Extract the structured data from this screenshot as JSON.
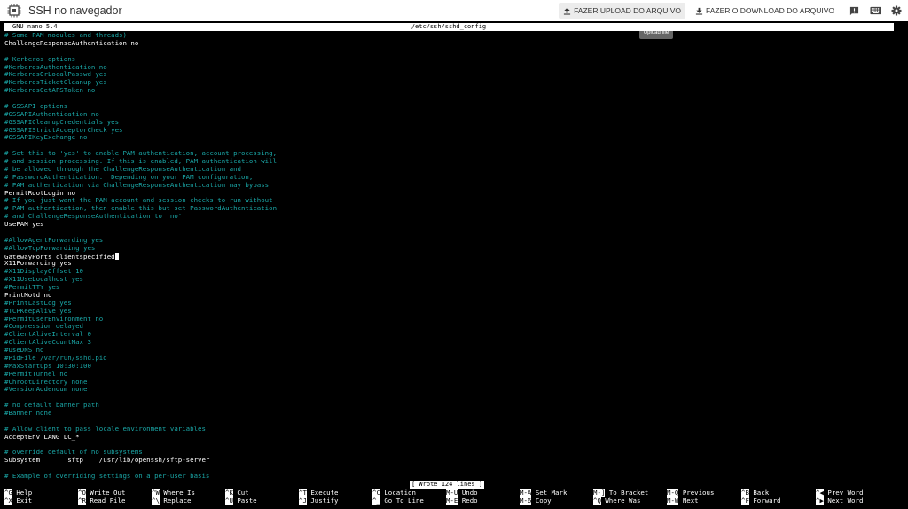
{
  "app": {
    "title": "SSH no navegador"
  },
  "toolbar": {
    "upload_label": "FAZER UPLOAD DO ARQUIVO",
    "download_label": "FAZER O DOWNLOAD DO ARQUIVO",
    "tooltip": "Upload file"
  },
  "nano": {
    "version": "GNU nano 5.4",
    "filename": "/etc/ssh/sshd_config",
    "status": "[ Wrote 124 lines ]"
  },
  "lines": [
    {
      "t": "# Some PAM modules and threads)",
      "c": true
    },
    {
      "t": "ChallengeResponseAuthentication no",
      "c": false
    },
    {
      "t": "",
      "c": false
    },
    {
      "t": "# Kerberos options",
      "c": true
    },
    {
      "t": "#KerberosAuthentication no",
      "c": true
    },
    {
      "t": "#KerberosOrLocalPasswd yes",
      "c": true
    },
    {
      "t": "#KerberosTicketCleanup yes",
      "c": true
    },
    {
      "t": "#KerberosGetAFSToken no",
      "c": true
    },
    {
      "t": "",
      "c": false
    },
    {
      "t": "# GSSAPI options",
      "c": true
    },
    {
      "t": "#GSSAPIAuthentication no",
      "c": true
    },
    {
      "t": "#GSSAPICleanupCredentials yes",
      "c": true
    },
    {
      "t": "#GSSAPIStrictAcceptorCheck yes",
      "c": true
    },
    {
      "t": "#GSSAPIKeyExchange no",
      "c": true
    },
    {
      "t": "",
      "c": false
    },
    {
      "t": "# Set this to 'yes' to enable PAM authentication, account processing,",
      "c": true
    },
    {
      "t": "# and session processing. If this is enabled, PAM authentication will",
      "c": true
    },
    {
      "t": "# be allowed through the ChallengeResponseAuthentication and",
      "c": true
    },
    {
      "t": "# PasswordAuthentication.  Depending on your PAM configuration,",
      "c": true
    },
    {
      "t": "# PAM authentication via ChallengeResponseAuthentication may bypass",
      "c": true
    },
    {
      "t": "PermitRootLogin no",
      "c": false
    },
    {
      "t": "# If you just want the PAM account and session checks to run without",
      "c": true
    },
    {
      "t": "# PAM authentication, then enable this but set PasswordAuthentication",
      "c": true
    },
    {
      "t": "# and ChallengeResponseAuthentication to 'no'.",
      "c": true
    },
    {
      "t": "UsePAM yes",
      "c": false
    },
    {
      "t": "",
      "c": false
    },
    {
      "t": "#AllowAgentForwarding yes",
      "c": true
    },
    {
      "t": "#AllowTcpForwarding yes",
      "c": true
    },
    {
      "t": "GatewayPorts clientspecified",
      "c": false,
      "cursor": true
    },
    {
      "t": "X11Forwarding yes",
      "c": false
    },
    {
      "t": "#X11DisplayOffset 10",
      "c": true
    },
    {
      "t": "#X11UseLocalhost yes",
      "c": true
    },
    {
      "t": "#PermitTTY yes",
      "c": true
    },
    {
      "t": "PrintMotd no",
      "c": false
    },
    {
      "t": "#PrintLastLog yes",
      "c": true
    },
    {
      "t": "#TCPKeepAlive yes",
      "c": true
    },
    {
      "t": "#PermitUserEnvironment no",
      "c": true
    },
    {
      "t": "#Compression delayed",
      "c": true
    },
    {
      "t": "#ClientAliveInterval 0",
      "c": true
    },
    {
      "t": "#ClientAliveCountMax 3",
      "c": true
    },
    {
      "t": "#UseDNS no",
      "c": true
    },
    {
      "t": "#PidFile /var/run/sshd.pid",
      "c": true
    },
    {
      "t": "#MaxStartups 10:30:100",
      "c": true
    },
    {
      "t": "#PermitTunnel no",
      "c": true
    },
    {
      "t": "#ChrootDirectory none",
      "c": true
    },
    {
      "t": "#VersionAddendum none",
      "c": true
    },
    {
      "t": "",
      "c": false
    },
    {
      "t": "# no default banner path",
      "c": true
    },
    {
      "t": "#Banner none",
      "c": true
    },
    {
      "t": "",
      "c": false
    },
    {
      "t": "# Allow client to pass locale environment variables",
      "c": true
    },
    {
      "t": "AcceptEnv LANG LC_*",
      "c": false
    },
    {
      "t": "",
      "c": false
    },
    {
      "t": "# override default of no subsystems",
      "c": true
    },
    {
      "t": "Subsystem       sftp    /usr/lib/openssh/sftp-server",
      "c": false
    },
    {
      "t": "",
      "c": false
    },
    {
      "t": "# Example of overriding settings on a per-user basis",
      "c": true
    }
  ],
  "shortcuts": [
    {
      "key": "^G",
      "label": "Help"
    },
    {
      "key": "^X",
      "label": "Exit"
    },
    {
      "key": "^O",
      "label": "Write Out"
    },
    {
      "key": "^R",
      "label": "Read File"
    },
    {
      "key": "^W",
      "label": "Where Is"
    },
    {
      "key": "^\\",
      "label": "Replace"
    },
    {
      "key": "^K",
      "label": "Cut"
    },
    {
      "key": "^U",
      "label": "Paste"
    },
    {
      "key": "^T",
      "label": "Execute"
    },
    {
      "key": "^J",
      "label": "Justify"
    },
    {
      "key": "^C",
      "label": "Location"
    },
    {
      "key": "^_",
      "label": "Go To Line"
    },
    {
      "key": "M-U",
      "label": "Undo"
    },
    {
      "key": "M-E",
      "label": "Redo"
    },
    {
      "key": "M-A",
      "label": "Set Mark"
    },
    {
      "key": "M-6",
      "label": "Copy"
    },
    {
      "key": "M-]",
      "label": "To Bracket"
    },
    {
      "key": "^Q",
      "label": "Where Was"
    },
    {
      "key": "M-Q",
      "label": "Previous"
    },
    {
      "key": "M-W",
      "label": "Next"
    },
    {
      "key": "^B",
      "label": "Back"
    },
    {
      "key": "^F",
      "label": "Forward"
    },
    {
      "key": "^◀",
      "label": "Prev Word"
    },
    {
      "key": "^▶",
      "label": "Next Word"
    }
  ]
}
